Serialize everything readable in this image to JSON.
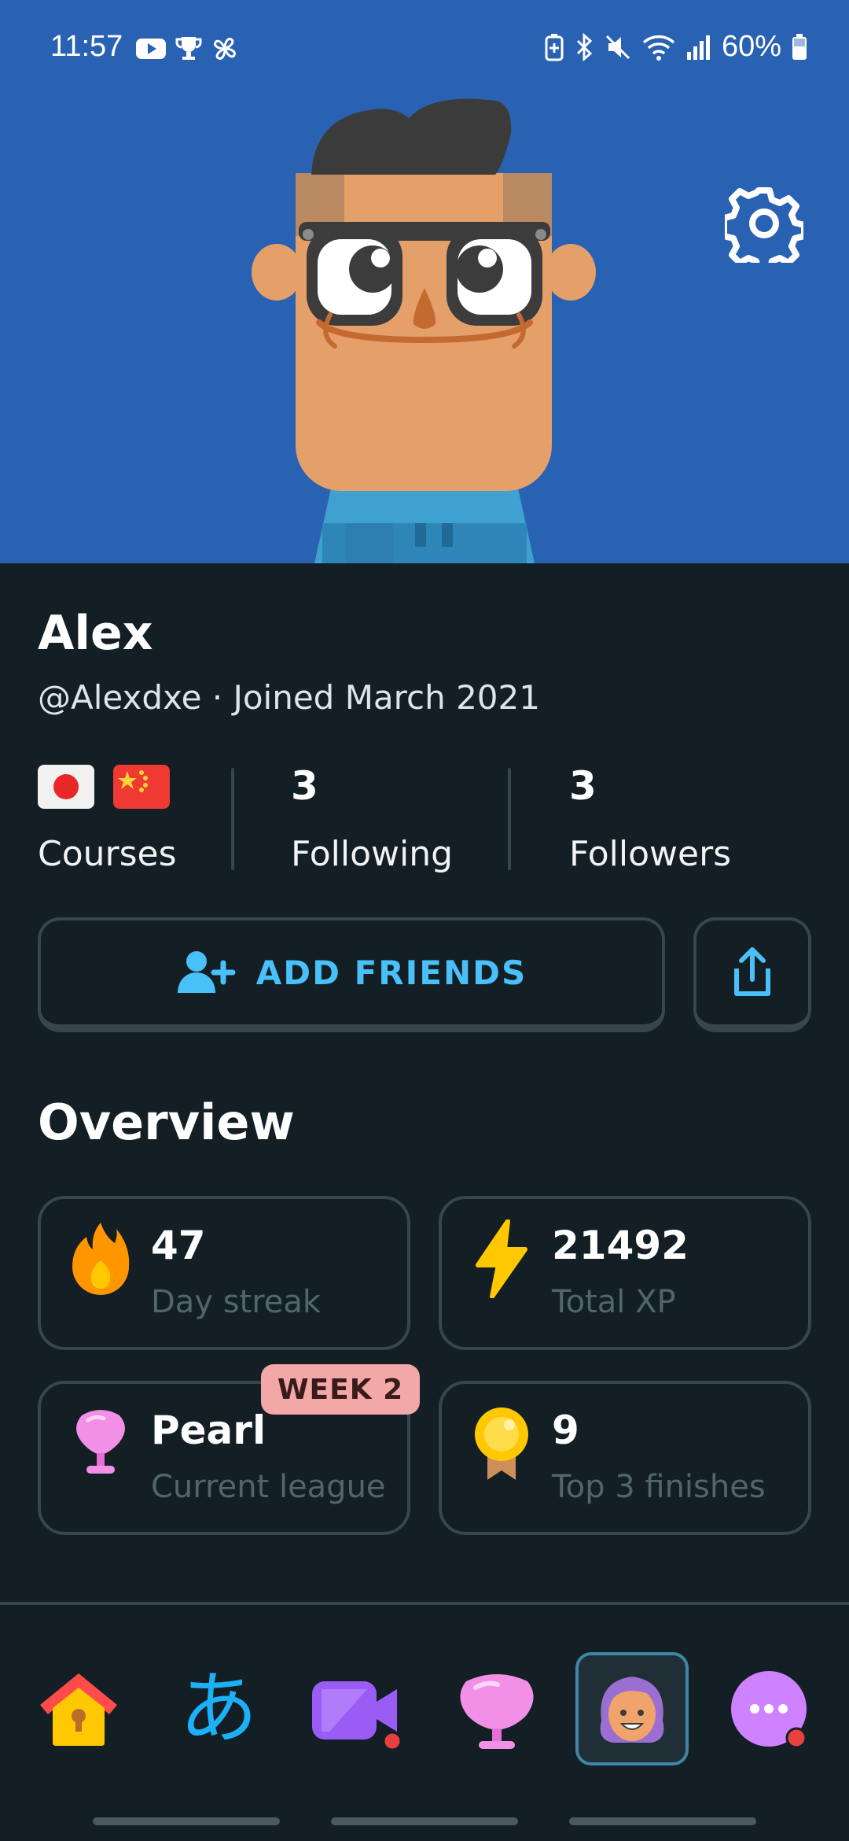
{
  "status_bar": {
    "time": "11:57",
    "battery": "60%",
    "left_icons": [
      "youtube-icon",
      "trophy-icon",
      "pinwheel-icon"
    ],
    "right_icons": [
      "battery-saver-icon",
      "bluetooth-icon",
      "mute-icon",
      "wifi-icon",
      "signal-icon",
      "battery-icon"
    ]
  },
  "header": {
    "background_color": "#2a62b3",
    "settings_icon": "gear-icon"
  },
  "profile": {
    "name": "Alex",
    "handle_line": "@Alexdxe · Joined March 2021"
  },
  "stats": {
    "courses_label": "Courses",
    "courses_flags": [
      "japan-flag-icon",
      "china-flag-icon"
    ],
    "following_value": "3",
    "following_label": "Following",
    "followers_value": "3",
    "followers_label": "Followers"
  },
  "actions": {
    "add_friends_label": "ADD FRIENDS",
    "add_friends_icon": "add-user-icon",
    "share_icon": "share-icon"
  },
  "overview": {
    "title": "Overview",
    "cards": [
      {
        "value": "47",
        "label": "Day streak",
        "icon": "flame-icon"
      },
      {
        "value": "21492",
        "label": "Total XP",
        "icon": "lightning-icon"
      },
      {
        "value": "Pearl",
        "label": "Current league",
        "icon": "pearl-trophy-icon",
        "badge": "WEEK 2"
      },
      {
        "value": "9",
        "label": "Top 3 finishes",
        "icon": "medal-icon"
      }
    ]
  },
  "bottom_nav": {
    "items": [
      {
        "name": "home",
        "icon": "home-icon"
      },
      {
        "name": "characters",
        "icon": "hiragana-icon",
        "glyph": "あ"
      },
      {
        "name": "video-call",
        "icon": "video-camera-icon"
      },
      {
        "name": "leagues",
        "icon": "pearl-trophy-icon"
      },
      {
        "name": "profile",
        "icon": "profile-avatar-icon",
        "active": true
      },
      {
        "name": "more",
        "icon": "more-icon"
      }
    ]
  },
  "colors": {
    "page_bg": "#131f24",
    "accent_blue": "#49c0f8",
    "border": "#37464f",
    "muted_text": "#52656d",
    "week_badge_bg": "#f3a8a8"
  }
}
